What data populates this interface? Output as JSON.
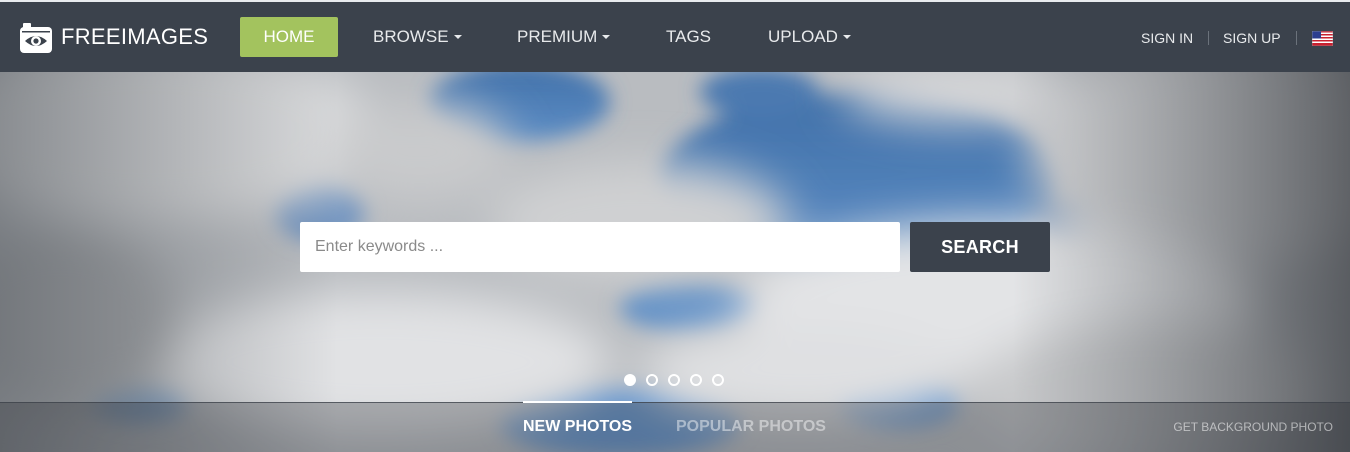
{
  "brand": {
    "logo_text": "FREEIMAGES",
    "logo_icon": "camera-eye-icon",
    "accent_color": "#a3c35e",
    "nav_color": "#3b424c"
  },
  "nav": {
    "home": "HOME",
    "browse": "BROWSE",
    "premium": "PREMIUM",
    "tags": "TAGS",
    "upload": "UPLOAD"
  },
  "account": {
    "sign_in": "SIGN IN",
    "sign_up": "SIGN UP",
    "language_icon": "us-flag-icon"
  },
  "search": {
    "placeholder": "Enter keywords ...",
    "button_label": "SEARCH"
  },
  "carousel": {
    "slide_count": 5,
    "active_slide": 1
  },
  "tabs": {
    "new_photos": "NEW PHOTOS",
    "popular_photos": "POPULAR PHOTOS",
    "active": "NEW PHOTOS"
  },
  "get_background": "GET BACKGROUND PHOTO"
}
